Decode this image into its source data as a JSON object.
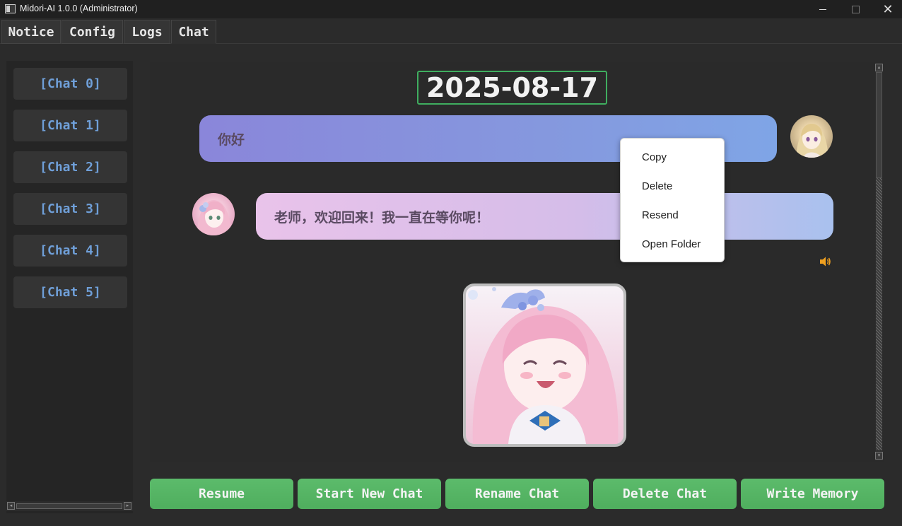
{
  "window": {
    "title": "Midori-AI 1.0.0 (Administrator)",
    "close_glyph": "✕"
  },
  "tabs": [
    {
      "label": "Notice"
    },
    {
      "label": "Config"
    },
    {
      "label": "Logs"
    },
    {
      "label": "Chat",
      "active": true
    }
  ],
  "sidebar": {
    "chats": [
      {
        "label": "[Chat 0]"
      },
      {
        "label": "[Chat 1]"
      },
      {
        "label": "[Chat 2]"
      },
      {
        "label": "[Chat 3]"
      },
      {
        "label": "[Chat 4]"
      },
      {
        "label": "[Chat 5]"
      }
    ]
  },
  "chat": {
    "date": "2025-08-17",
    "messages": [
      {
        "role": "user",
        "text": "你好"
      },
      {
        "role": "assistant",
        "text": "老师，欢迎回来！我一直在等你呢！"
      }
    ]
  },
  "context_menu": {
    "items": [
      {
        "label": "Copy"
      },
      {
        "label": "Delete"
      },
      {
        "label": "Resend"
      },
      {
        "label": "Open Folder"
      }
    ]
  },
  "actions": {
    "resume": "Resume",
    "start_new_chat": "Start New Chat",
    "rename_chat": "Rename Chat",
    "delete_chat": "Delete Chat",
    "write_memory": "Write Memory"
  },
  "colors": {
    "accent_green": "#4fae5e",
    "chat_link_blue": "#6f9fd8",
    "date_border": "#3fae5f",
    "speaker_orange": "#f0a020"
  },
  "icons": {
    "app": "app-icon",
    "speaker": "speaker-icon",
    "minimize": "minimize-icon",
    "maximize": "maximize-icon",
    "close": "close-icon"
  }
}
